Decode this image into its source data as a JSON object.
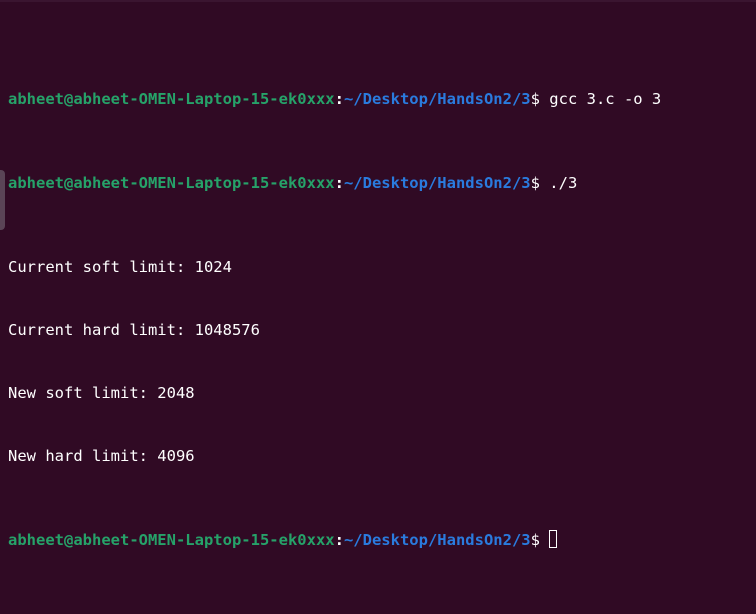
{
  "prompt": {
    "user_host": "abheet@abheet-OMEN-Laptop-15-ek0xxx",
    "separator": ":",
    "path": "~/Desktop/HandsOn2/3",
    "symbol": "$"
  },
  "lines": [
    {
      "type": "prompt",
      "command": " gcc 3.c -o 3"
    },
    {
      "type": "prompt",
      "command": " ./3"
    },
    {
      "type": "output",
      "text": "Current soft limit: 1024"
    },
    {
      "type": "output",
      "text": "Current hard limit: 1048576"
    },
    {
      "type": "output",
      "text": "New soft limit: 2048"
    },
    {
      "type": "output",
      "text": "New hard limit: 4096"
    },
    {
      "type": "prompt",
      "command": " "
    }
  ],
  "colors": {
    "background": "#300a24",
    "user_host": "#26a269",
    "path": "#2a7bde",
    "text": "#ffffff"
  }
}
